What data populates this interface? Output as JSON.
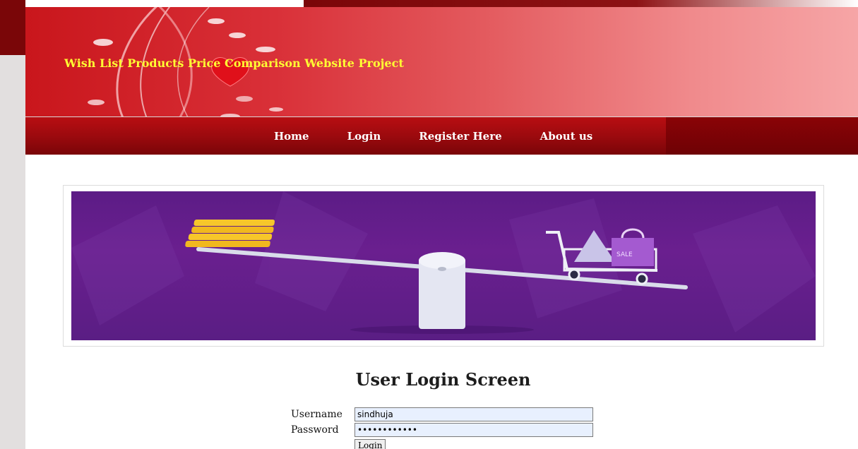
{
  "header": {
    "site_title": "Wish List Products Price Comparison Website Project"
  },
  "nav": {
    "items": [
      {
        "label": "Home"
      },
      {
        "label": "Login"
      },
      {
        "label": "Register Here"
      },
      {
        "label": "About us"
      }
    ]
  },
  "hero": {
    "image_label": "SALE",
    "icons": [
      "coin-stack-icon",
      "seesaw-scale-icon",
      "shopping-cart-icon",
      "shopping-bag-icon"
    ]
  },
  "login": {
    "title": "User Login Screen",
    "username_label": "Username",
    "username_value": "sindhuja",
    "password_label": "Password",
    "password_value": "sindhuja1234",
    "submit_label": "Login"
  },
  "colors": {
    "title_yellow": "#ffff33",
    "nav_red": "#9c0a0e",
    "hero_purple": "#5c1c86"
  }
}
